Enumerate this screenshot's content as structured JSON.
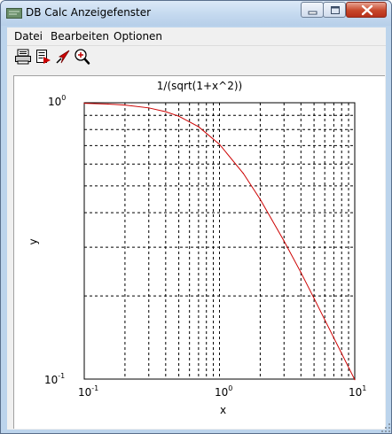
{
  "window": {
    "title": "DB Calc Anzeigefenster",
    "controls": {
      "minimize": "minimize",
      "maximize": "maximize",
      "close": "close"
    }
  },
  "menu": {
    "items": [
      "Datei",
      "Bearbeiten",
      "Optionen"
    ]
  },
  "toolbar": {
    "icons": [
      "printer-icon",
      "export-icon",
      "cursor-icon",
      "zoom-icon"
    ]
  },
  "chart_data": {
    "type": "line",
    "title": "1/(sqrt(1+x^2))",
    "xlabel": "x",
    "ylabel": "y",
    "xscale": "log",
    "yscale": "log",
    "xlim": [
      0.1,
      10
    ],
    "ylim": [
      0.1,
      1
    ],
    "x_ticks": [
      {
        "base": "10",
        "exp": "-1"
      },
      {
        "base": "10",
        "exp": "0"
      },
      {
        "base": "10",
        "exp": "1"
      }
    ],
    "y_ticks": [
      {
        "base": "10",
        "exp": "0"
      },
      {
        "base": "10",
        "exp": "-1"
      }
    ],
    "grid": true,
    "line_color": "#cc0000",
    "x": [
      0.1,
      0.15,
      0.2,
      0.3,
      0.4,
      0.5,
      0.7,
      1,
      1.5,
      2,
      3,
      4,
      5,
      7,
      10
    ],
    "series": [
      {
        "values": [
          0.995,
          0.989,
          0.981,
          0.958,
          0.928,
          0.894,
          0.819,
          0.707,
          0.555,
          0.447,
          0.316,
          0.243,
          0.196,
          0.141,
          0.0995
        ]
      }
    ]
  }
}
